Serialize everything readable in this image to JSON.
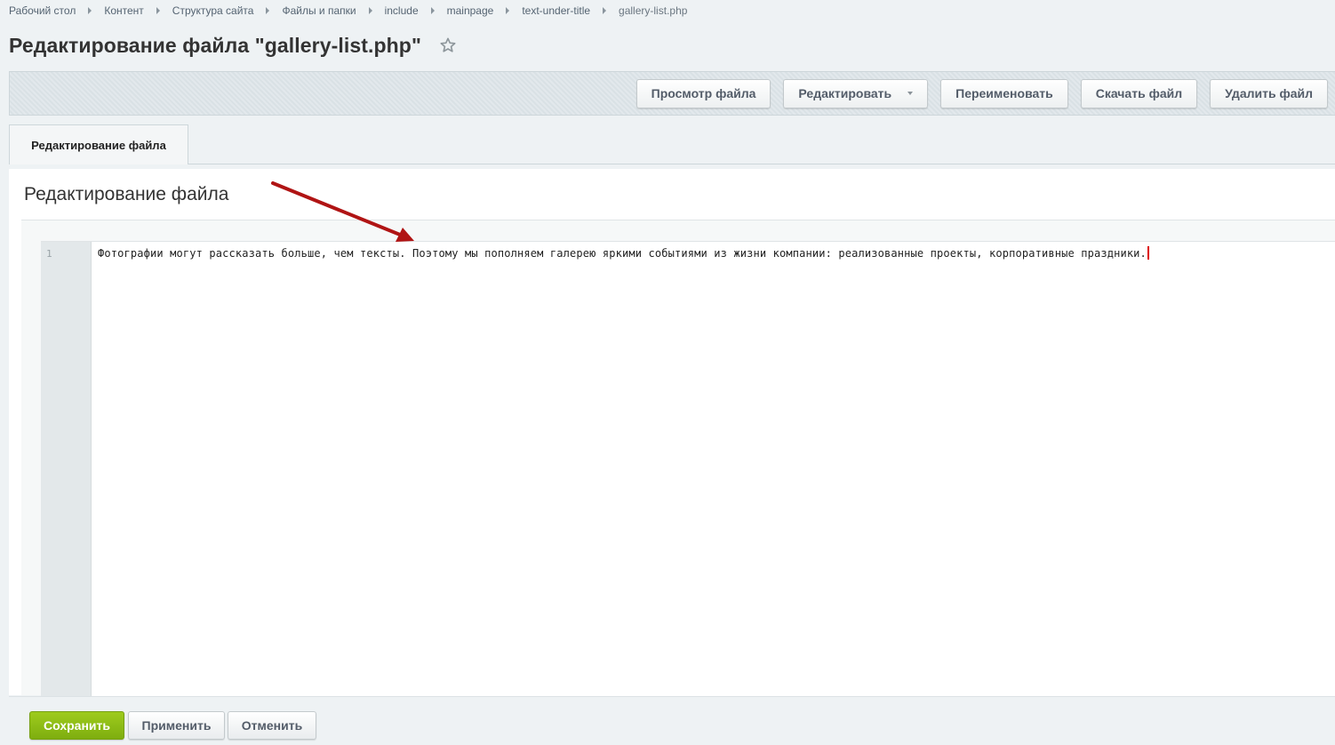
{
  "breadcrumbs": [
    {
      "label": "Рабочий стол"
    },
    {
      "label": "Контент"
    },
    {
      "label": "Структура сайта"
    },
    {
      "label": "Файлы и папки"
    },
    {
      "label": "include"
    },
    {
      "label": "mainpage"
    },
    {
      "label": "text-under-title"
    },
    {
      "label": "gallery-list.php"
    }
  ],
  "page": {
    "title": "Редактирование файла \"gallery-list.php\"",
    "favorite_icon": "star-outline-icon"
  },
  "toolbar": {
    "view_label": "Просмотр файла",
    "edit_label": "Редактировать",
    "rename_label": "Переименовать",
    "download_label": "Скачать файл",
    "delete_label": "Удалить файл"
  },
  "tabs": [
    {
      "label": "Редактирование файла",
      "active": true
    }
  ],
  "section": {
    "title": "Редактирование файла"
  },
  "editor": {
    "lines": [
      {
        "number": "1",
        "text": "Фотографии могут рассказать больше, чем тексты. Поэтому мы пополняем галерею яркими событиями из жизни компании: реализованные проекты, корпоративные праздники."
      }
    ]
  },
  "annotation": {
    "color": "#b01414",
    "icon": "arrow-annotation"
  },
  "footer": {
    "save_label": "Сохранить",
    "apply_label": "Применить",
    "cancel_label": "Отменить"
  },
  "colors": {
    "save_green": "#8cbc14",
    "toolbar_bg": "#d9e1e5",
    "cursor": "#dd0000"
  }
}
